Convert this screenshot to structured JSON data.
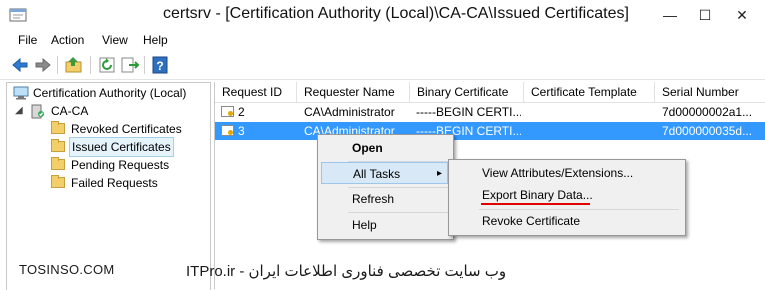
{
  "window": {
    "title": "certsrv - [Certification Authority (Local)\\CA-CA\\Issued Certificates]",
    "controls": {
      "minimize": "—",
      "maximize": "☐",
      "close": "✕"
    }
  },
  "menubar": [
    "File",
    "Action",
    "View",
    "Help"
  ],
  "toolbar": [
    "back-icon",
    "forward-icon",
    "up-folder-icon",
    "refresh-icon",
    "export-list-icon",
    "help-icon"
  ],
  "tree": {
    "root": "Certification Authority (Local)",
    "ca": "CA-CA",
    "folders": [
      "Revoked Certificates",
      "Issued Certificates",
      "Pending Requests",
      "Failed Requests"
    ],
    "selected": "Issued Certificates"
  },
  "list": {
    "columns": [
      "Request ID",
      "Requester Name",
      "Binary Certificate",
      "Certificate Template",
      "Serial Number"
    ],
    "rows": [
      {
        "id": "2",
        "requester": "CA\\Administrator",
        "binary": "-----BEGIN CERTI...",
        "template": "",
        "serial": "7d00000002a1..."
      },
      {
        "id": "3",
        "requester": "CA\\Administrator",
        "binary": "-----BEGIN CERTI...",
        "template": "",
        "serial": "7d000000035d..."
      }
    ],
    "selected_row": "3"
  },
  "context_menu": {
    "items": [
      "Open",
      "All Tasks",
      "Refresh",
      "Help"
    ],
    "submenu_arrow": "▸"
  },
  "submenu": {
    "items": [
      "View Attributes/Extensions...",
      "Export Binary Data...",
      "Revoke Certificate"
    ]
  },
  "watermark": {
    "left": "TOSINSO.COM",
    "right": "ITPro.ir - وب سایت تخصصی فناوری اطلاعات ایران"
  },
  "colors": {
    "selection": "#3399ff",
    "underline": "#e00000"
  }
}
